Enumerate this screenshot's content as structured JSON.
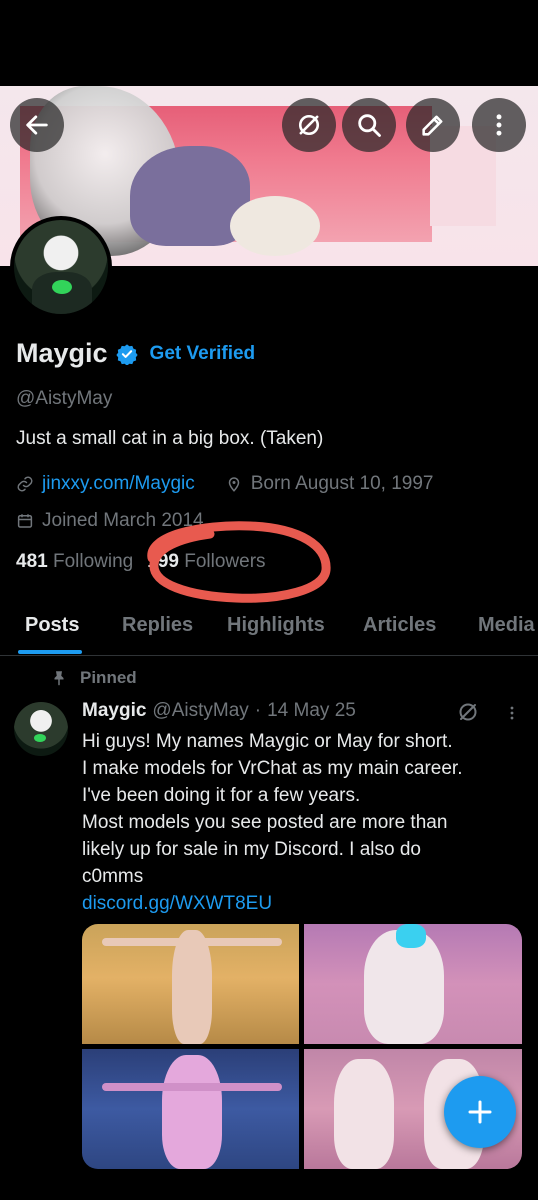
{
  "profile": {
    "name": "Maygic",
    "get_verified": "Get Verified",
    "handle": "@AistyMay",
    "bio": "Just a small cat in a big box. (Taken)",
    "website": "jinxxy.com/Maygic",
    "birthday": "Born August 10, 1997",
    "joined": "Joined March 2014",
    "following_count": "481",
    "following_label": "Following",
    "followers_count": "199",
    "followers_label": "Followers"
  },
  "tabs": [
    "Posts",
    "Replies",
    "Highlights",
    "Articles",
    "Media"
  ],
  "pinned_label": "Pinned",
  "post": {
    "name": "Maygic",
    "handle": "@AistyMay",
    "dot": "·",
    "date": "14 May 25",
    "lines": [
      "Hi guys! My names Maygic or May for short.",
      "I make models for VrChat as my main career.",
      "I've been doing it for a few years.",
      "Most models you see posted are more than",
      "likely up for sale in my Discord. I also do",
      "c0mms"
    ],
    "link": "discord.gg/WXWT8EU"
  },
  "icons": {
    "back": "back-arrow-icon",
    "grok": "grok-icon",
    "search": "search-icon",
    "edit": "edit-icon",
    "more": "more-vertical-icon",
    "verified": "verified-badge-icon",
    "link": "link-icon",
    "location": "location-pin-icon",
    "calendar": "calendar-icon",
    "pin": "pin-icon",
    "compose": "plus-icon"
  },
  "colors": {
    "accent": "#1d9bf0",
    "annotation": "#e85a4f"
  }
}
